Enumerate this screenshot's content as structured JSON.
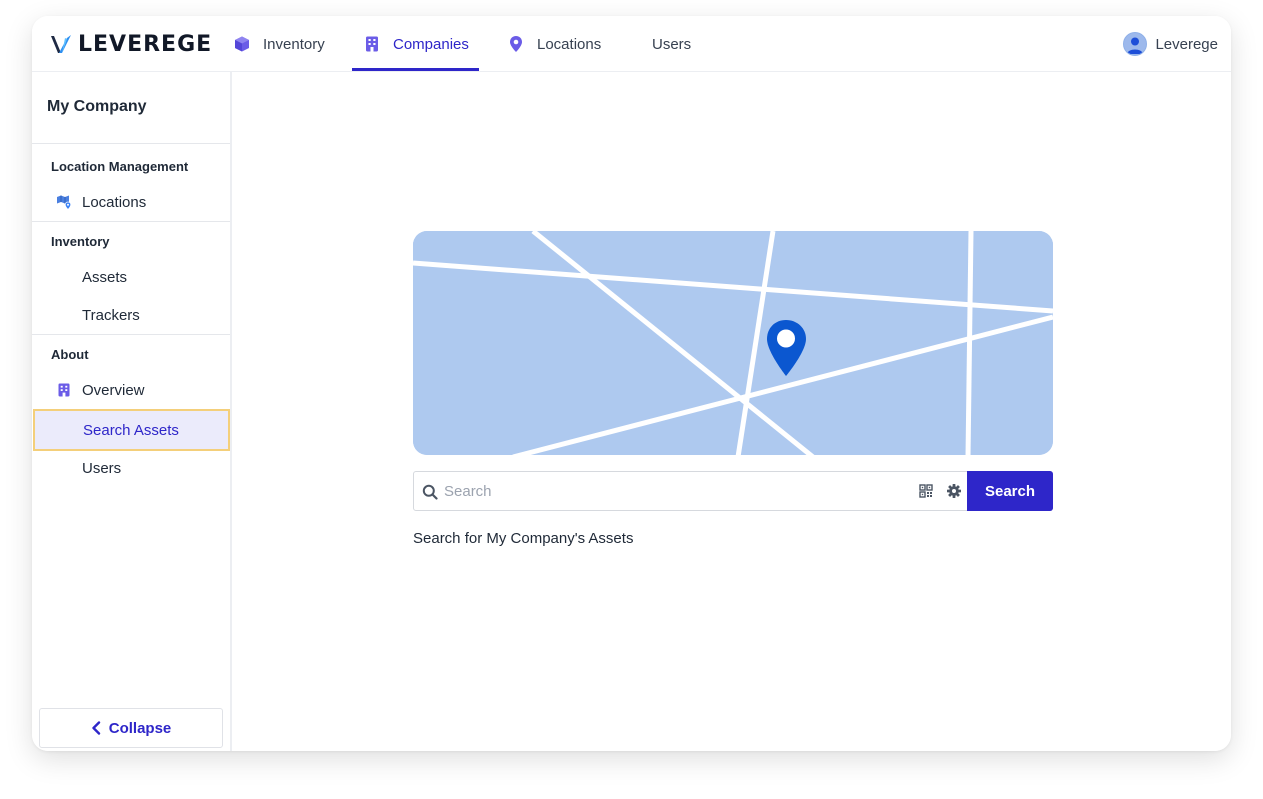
{
  "brand": {
    "name": "LEVEREGE"
  },
  "nav": {
    "items": [
      {
        "label": "Inventory",
        "icon": "cube-icon"
      },
      {
        "label": "Companies",
        "icon": "building-icon",
        "active": true
      },
      {
        "label": "Locations",
        "icon": "map-pin-icon"
      },
      {
        "label": "Users"
      }
    ],
    "user": {
      "name": "Leverege",
      "icon": "user-avatar-icon"
    }
  },
  "sidebar": {
    "company": "My Company",
    "sections": [
      {
        "title": "Location Management",
        "items": [
          {
            "label": "Locations",
            "icon": "map-location-icon"
          }
        ]
      },
      {
        "title": "Inventory",
        "items": [
          {
            "label": "Assets"
          },
          {
            "label": "Trackers"
          }
        ]
      },
      {
        "title": "About",
        "items": [
          {
            "label": "Overview",
            "icon": "building-icon"
          },
          {
            "label": "Search Assets",
            "selected": true
          },
          {
            "label": "Users"
          }
        ]
      }
    ],
    "collapse_label": "Collapse"
  },
  "search": {
    "placeholder": "Search",
    "value": "",
    "button_label": "Search",
    "hint": "Search for My Company's Assets"
  },
  "colors": {
    "accent": "#2e26c9",
    "map_bg": "#aec9ef",
    "pin": "#0b57d0",
    "selected_bg": "#ebebfb",
    "selected_border": "#f4cf7a"
  }
}
